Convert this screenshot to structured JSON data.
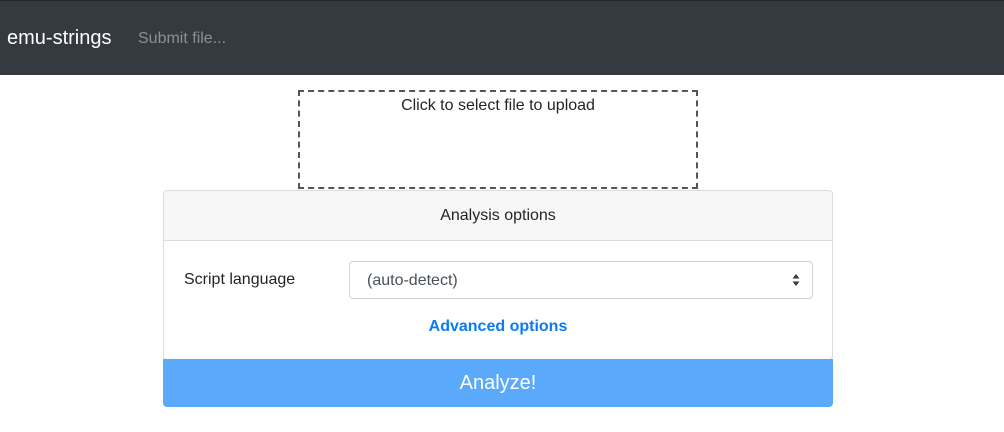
{
  "navbar": {
    "brand": "emu-strings",
    "submit_link": "Submit file...",
    "background": "#343a40"
  },
  "upload": {
    "prompt": "Click to select file to upload"
  },
  "options": {
    "header": "Analysis options",
    "script_language_label": "Script language",
    "script_language_value": "(auto-detect)",
    "advanced_link": "Advanced options",
    "link_color": "#0b7bf2"
  },
  "actions": {
    "analyze_label": "Analyze!",
    "analyze_color": "#5aa9fb"
  }
}
